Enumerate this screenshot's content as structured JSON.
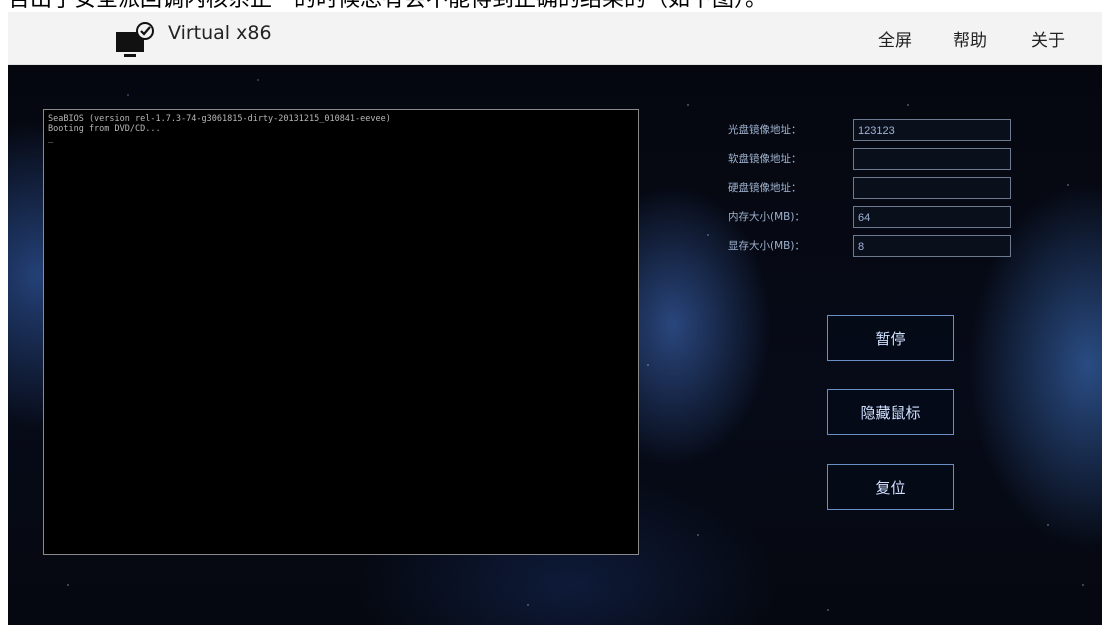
{
  "caption": "告出了安全派回调内核系正一的时候总有会不能得到正确的结果的（如下图）。",
  "app": {
    "title": "Virtual x86",
    "icon": "monitor-check-icon"
  },
  "menu": {
    "fullscreen": "全屏",
    "help": "帮助",
    "about": "关于"
  },
  "console": {
    "lines": [
      "SeaBIOS (version rel-1.7.3-74-g3061815-dirty-20131215_010841-eevee)",
      "Booting from DVD/CD...",
      "_"
    ]
  },
  "settings": {
    "cdrom_label": "光盘镜像地址：",
    "cdrom_value": "123123",
    "floppy_label": "软盘镜像地址：",
    "floppy_value": "",
    "hdd_label": "硬盘镜像地址：",
    "hdd_value": "",
    "memory_label": "内存大小(MB)：",
    "memory_value": "64",
    "vram_label": "显存大小(MB)：",
    "vram_value": "8"
  },
  "buttons": {
    "pause": "暂停",
    "hide_mouse": "隐藏鼠标",
    "reset": "复位"
  }
}
